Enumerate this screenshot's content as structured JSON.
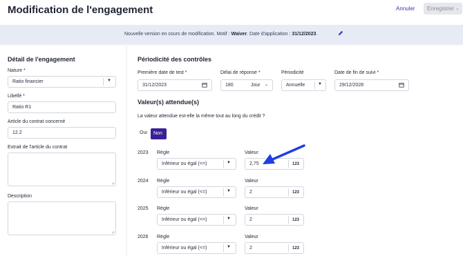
{
  "header": {
    "title": "Modification de l'engagement",
    "cancel_label": "Annuler",
    "save_label": "Enregistrer"
  },
  "banner": {
    "prefix": "Nouvelle version en cours de modification. Motif : ",
    "motif": "Waiver",
    "middle": ". Date d'application : ",
    "date": "31/12/2023",
    "suffix": "."
  },
  "detail": {
    "heading": "Détail de l'engagement",
    "nature_label": "Nature *",
    "nature_value": "Ratio financier",
    "libelle_label": "Libellé *",
    "libelle_value": "Ratio R1",
    "article_label": "Article du contrat concerné",
    "article_value": "12.2",
    "extrait_label": "Extrait de l'article du contrat",
    "description_label": "Description"
  },
  "periodicite": {
    "heading": "Périodicité des contrôles",
    "first_date_label": "Première date de test *",
    "first_date_value": "31/12/2023",
    "delai_label": "Délai de réponse *",
    "delai_value": "180",
    "delai_unit": "Jour",
    "periodicite_label": "Périodicité",
    "periodicite_value": "Annuelle",
    "fin_label": "Date de fin de suivi *",
    "fin_value": "29/12/2028"
  },
  "valeurs": {
    "heading": "Valeur(s) attendue(s)",
    "question": "La valeur attendue est-elle la même tout au long du crédit ?",
    "oui": "Oui",
    "non": "Non",
    "rule_label": "Règle",
    "value_label": "Valeur",
    "unit_badge": "123",
    "rows": [
      {
        "year": "2023",
        "rule": "Inférieur ou égal (<=)",
        "value": "2,75"
      },
      {
        "year": "2024",
        "rule": "Inférieur ou égal (<=)",
        "value": "2"
      },
      {
        "year": "2025",
        "rule": "Inférieur ou égal (<=)",
        "value": "2"
      },
      {
        "year": "2026",
        "rule": "Inférieur ou égal (<=)",
        "value": "2"
      }
    ]
  },
  "annotation": {
    "arrow_color": "#1f3fe0"
  }
}
